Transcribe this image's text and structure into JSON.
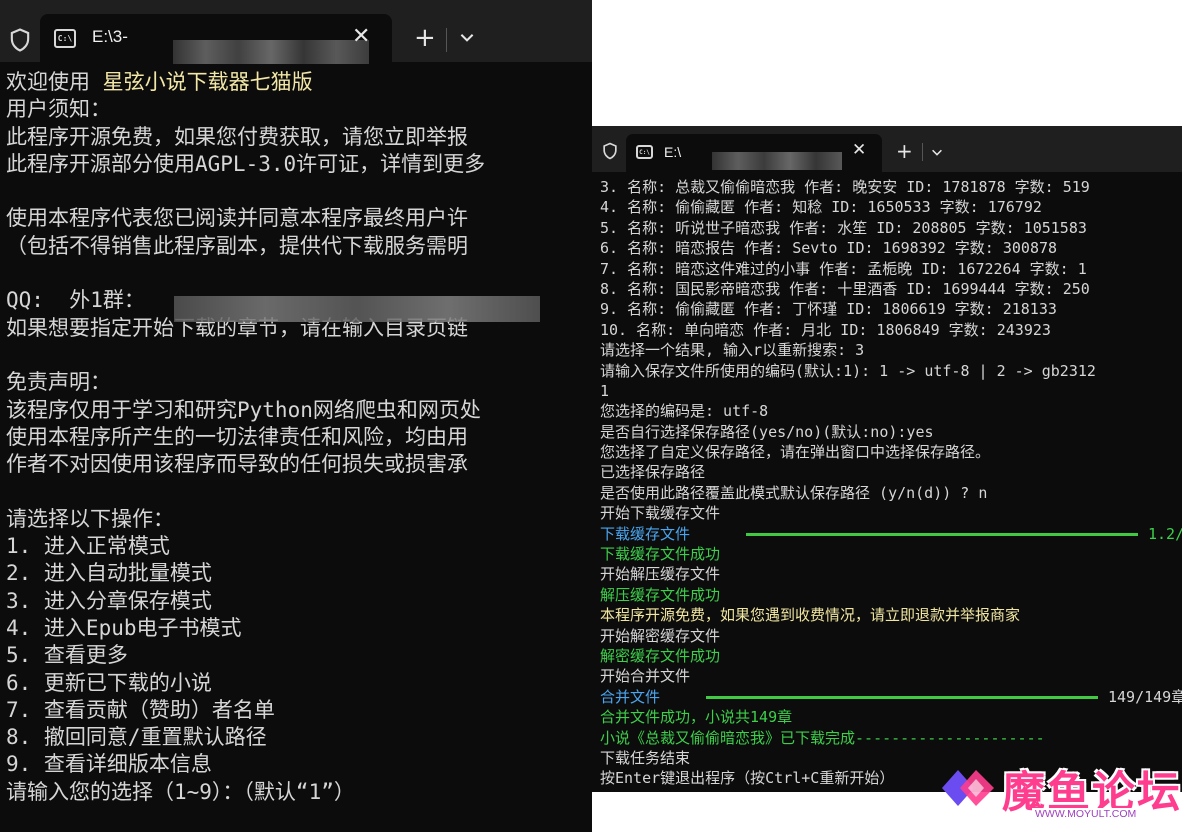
{
  "window_left": {
    "tab_title": "E:\\3-",
    "close_glyph": "✕",
    "new_tab_glyph": "+",
    "lines": [
      "欢迎使用 ",
      "用户须知：",
      "此程序开源免费，如果您付费获取，请您立即举报",
      "此程序开源部分使用AGPL-3.0许可证，详情到更多",
      "",
      "使用本程序代表您已阅读并同意本程序最终用户许",
      "（包括不得销售此程序副本，提供代下载服务需明",
      "",
      "QQ:  外1群：",
      "如果想要指定开始下载的章节，请在输入目录页链",
      "",
      "免责声明：",
      "该程序仅用于学习和研究Python网络爬虫和网页处",
      "使用本程序所产生的一切法律责任和风险，均由用",
      "作者不对因使用该程序而导致的任何损失或损害承",
      "",
      "请选择以下操作：",
      "1. 进入正常模式",
      "2. 进入自动批量模式",
      "3. 进入分章保存模式",
      "4. 进入Epub电子书模式",
      "5. 查看更多",
      "6. 更新已下载的小说",
      "7. 查看贡献（赞助）者名单",
      "8. 撤回同意/重置默认路径",
      "9. 查看详细版本信息",
      "请输入您的选择（1~9）：（默认“1”）"
    ],
    "app_name": "星弦小说下载器七猫版"
  },
  "window_right": {
    "tab_title": "E:\\",
    "close_glyph": "✕",
    "new_tab_glyph": "+",
    "lines": [
      "3. 名称: 总裁又偷偷暗恋我 作者: 晚安安 ID: 1781878 字数: 519",
      "4. 名称: 偷偷藏匿 作者: 知稔 ID: 1650533 字数: 176792",
      "5. 名称: 听说世子暗恋我 作者: 水笙 ID: 208805 字数: 1051583",
      "6. 名称: 暗恋报告 作者: Sevto ID: 1698392 字数: 300878",
      "7. 名称: 暗恋这件难过的小事 作者: 孟栀晚 ID: 1672264 字数: 1",
      "8. 名称: 国民影帝暗恋我 作者: 十里酒香 ID: 1699444 字数: 250",
      "9. 名称: 偷偷藏匿 作者: 丁怀瑾 ID: 1806619 字数: 218133",
      "10. 名称: 单向暗恋 作者: 月北 ID: 1806849 字数: 243923",
      "请选择一个结果, 输入r以重新搜索: 3",
      "请输入保存文件所使用的编码(默认:1): 1 -> utf-8 | 2 -> gb2312",
      "1",
      "您选择的编码是: utf-8",
      "是否自行选择保存路径(yes/no)(默认:no):yes",
      "您选择了自定义保存路径，请在弹出窗口中选择保存路径。",
      "已选择保存路径",
      "是否使用此路径覆盖此模式默认保存路径 (y/n(d)) ? n",
      "开始下载缓存文件"
    ],
    "progress1": {
      "label": "下载缓存文件",
      "value": "1.2/",
      "fraction": 1.0
    },
    "lines_mid": [
      {
        "text": "下载缓存文件成功",
        "color": "green"
      },
      {
        "text": "开始解压缓存文件",
        "color": "white"
      },
      {
        "text": "解压缓存文件成功",
        "color": "green"
      },
      {
        "text": "本程序开源免费，如果您遇到收费情况，请立即退款并举报商家",
        "color": "yellow"
      },
      {
        "text": "开始解密缓存文件",
        "color": "white"
      },
      {
        "text": "解密缓存文件成功",
        "color": "green"
      },
      {
        "text": "开始合并文件",
        "color": "white"
      }
    ],
    "progress2": {
      "label": "合并文件",
      "value": "149/149章",
      "fraction": 1.0
    },
    "lines_end": [
      {
        "text": "合并文件成功，小说共149章",
        "color": "green"
      },
      {
        "text": "小说《总裁又偷偷暗恋我》已下载完成---------------------",
        "color": "green"
      },
      {
        "text": "下载任务结束",
        "color": "white"
      },
      {
        "text": "按Enter键退出程序（按Ctrl+C重新开始）",
        "color": "white"
      }
    ]
  },
  "watermark": {
    "name": "魔鱼论坛",
    "url": "WWW.MOYULT.COM"
  },
  "colors": {
    "terminal_bg": "#0c0c0c",
    "tabbar_bg": "#1f1f1f",
    "highlight": "#f2e7a6",
    "progress_green": "#41c943",
    "info_blue": "#4aa6f0",
    "watermark_pink": "#ff3d8e"
  }
}
